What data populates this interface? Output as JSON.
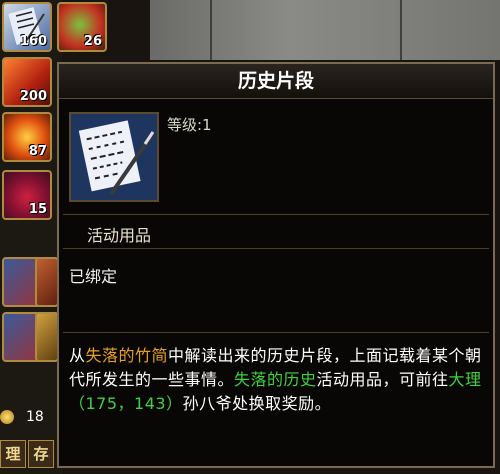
{
  "inventory": {
    "slots": [
      {
        "name": "scroll",
        "count": "160"
      },
      {
        "name": "fruit",
        "count": "26"
      },
      {
        "name": "red-box",
        "count": "200"
      },
      {
        "name": "fire-orb",
        "count": "87"
      },
      {
        "name": "berries",
        "count": "15"
      }
    ],
    "gold_count": "18",
    "buttons": [
      "理",
      "存"
    ]
  },
  "tooltip": {
    "title": "历史片段",
    "level": "等级:1",
    "category": "活动用品",
    "bound": "已绑定",
    "desc": {
      "p1": "从",
      "item1": "失落的竹简",
      "p2": "中解读出来的历史片段，上面记载着某个朝代所发生的一些事情。",
      "item2": "失落的历史",
      "p3": "活动用品，可前往",
      "location": "大理（175，143）",
      "p4": "孙八爷处换取奖励。"
    }
  },
  "colors": {
    "highlight_orange": "#e8a020",
    "highlight_green": "#40d040",
    "frame_gold": "#b08a3e"
  }
}
